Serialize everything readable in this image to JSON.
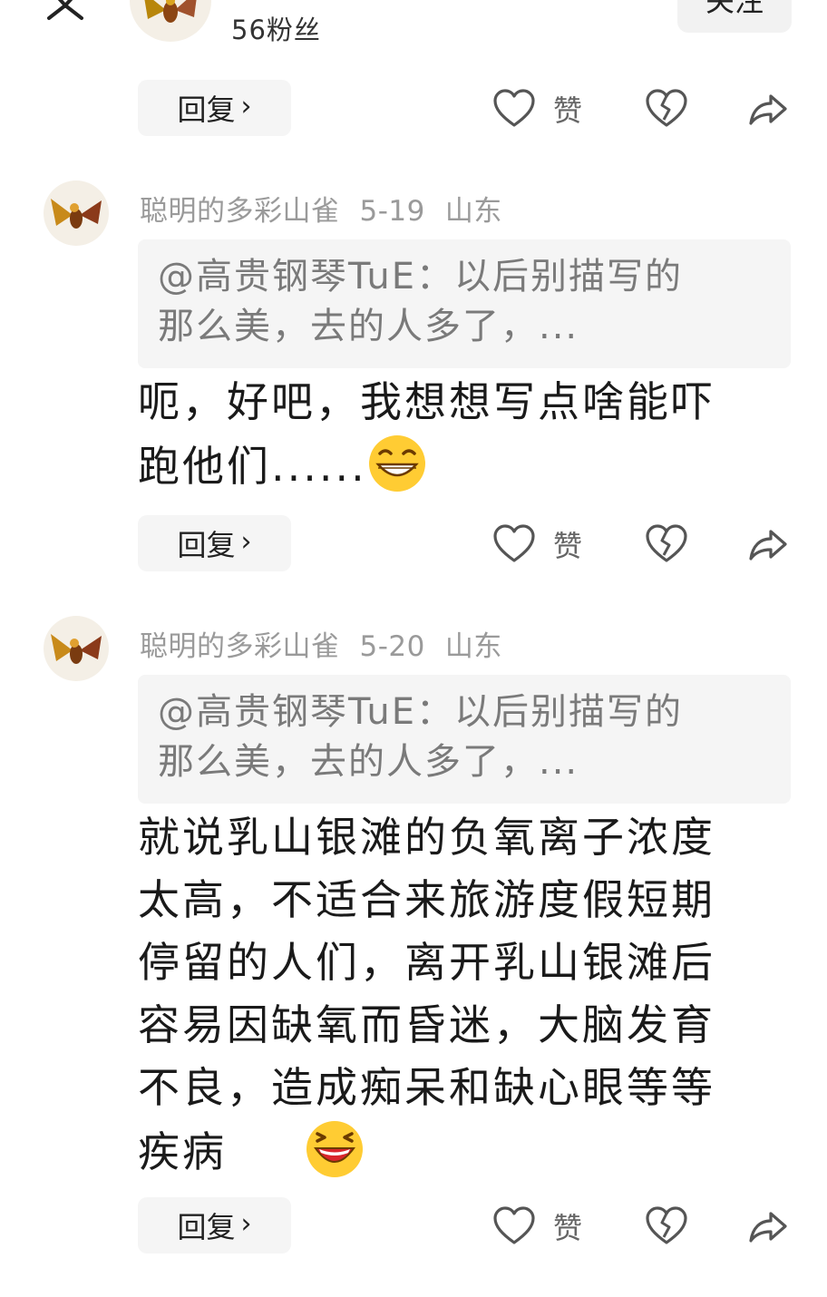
{
  "header": {
    "fans_text": "56粉丝",
    "follow_label": "关注"
  },
  "actions": {
    "reply_label": "回复",
    "like_label": "赞"
  },
  "comments": [
    {
      "username": "聪明的多彩山雀",
      "date": "5-19",
      "location": "山东",
      "quote": "@高贵钢琴TuE：以后别描写的那么美，去的人多了，...",
      "quote_line1": "@高贵钢琴TuE：以后别描写的",
      "quote_line2": "那么美，去的人多了，...",
      "text_lines": [
        "呃，好吧，我想想写点啥能吓",
        "跑他们......"
      ],
      "emoji": "grinning-teeth-emoji"
    },
    {
      "username": "聪明的多彩山雀",
      "date": "5-20",
      "location": "山东",
      "quote_line1": "@高贵钢琴TuE：以后别描写的",
      "quote_line2": "那么美，去的人多了，...",
      "text_lines": [
        "就说乳山银滩的负氧离子浓度",
        "太高，不适合来旅游度假短期",
        "停留的人们，离开乳山银滩后",
        "容易因缺氧而昏迷，大脑发育",
        "不良，造成痴呆和缺心眼等等",
        "疾病"
      ],
      "emoji": "laughing-emoji"
    }
  ],
  "colors": {
    "meta_gray": "#9a9a9a",
    "quote_bg": "#f5f5f5",
    "pill_bg": "#f5f5f5",
    "icon_gray": "#555555"
  }
}
